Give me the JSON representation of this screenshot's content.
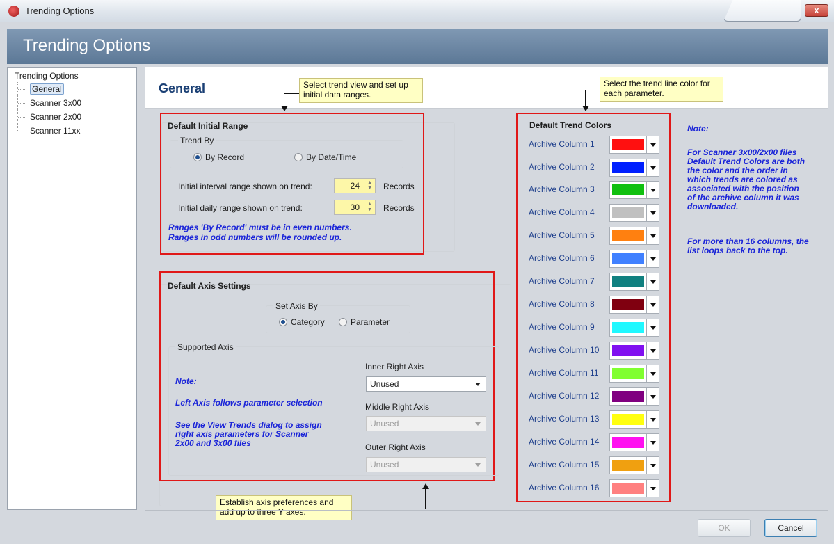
{
  "window": {
    "title": "Trending Options",
    "close_label": "x"
  },
  "banner": {
    "title": "Trending Options"
  },
  "tree": {
    "root": "Trending Options",
    "items": [
      {
        "label": "General"
      },
      {
        "label": "Scanner 3x00"
      },
      {
        "label": "Scanner 2x00"
      },
      {
        "label": "Scanner 11xx"
      }
    ]
  },
  "page": {
    "title": "General"
  },
  "callouts": {
    "trend_view": "Select trend view and set up initial data ranges.",
    "trend_color": "Select the trend line color for each parameter.",
    "axis": "Establish axis preferences and add up to three Y axes."
  },
  "initial_range": {
    "title": "Default Initial Range",
    "trend_by_title": "Trend By",
    "by_record": "By Record",
    "by_datetime": "By Date/Time",
    "selected": "By Record",
    "interval_label": "Initial interval range shown on trend:",
    "interval_value": "24",
    "daily_label": "Initial daily range shown on trend:",
    "daily_value": "30",
    "unit": "Records",
    "note_line1": "Ranges 'By Record' must be in even numbers.",
    "note_line2": "Ranges in odd numbers will be rounded up."
  },
  "axis": {
    "title": "Default Axis Settings",
    "set_axis_title": "Set Axis By",
    "category": "Category",
    "parameter": "Parameter",
    "selected": "Category",
    "supported_title": "Supported Axis",
    "note_title": "Note:",
    "note_left": "Left Axis follows parameter selection",
    "note_view_line1": "See the View Trends dialog to assign",
    "note_view_line2": "right axis parameters for Scanner",
    "note_view_line3": "2x00 and 3x00 files",
    "inner_label": "Inner Right Axis",
    "inner_value": "Unused",
    "middle_label": "Middle Right Axis",
    "middle_value": "Unused",
    "outer_label": "Outer Right Axis",
    "outer_value": "Unused"
  },
  "colors": {
    "title": "Default Trend Colors",
    "columns": [
      {
        "label": "Archive Column 1",
        "color": "#ff1010"
      },
      {
        "label": "Archive Column 2",
        "color": "#0020ff"
      },
      {
        "label": "Archive Column 3",
        "color": "#10c010"
      },
      {
        "label": "Archive Column 4",
        "color": "#c0c0c0"
      },
      {
        "label": "Archive Column 5",
        "color": "#ff8010"
      },
      {
        "label": "Archive Column 6",
        "color": "#4080ff"
      },
      {
        "label": "Archive Column 7",
        "color": "#108080"
      },
      {
        "label": "Archive Column 8",
        "color": "#800010"
      },
      {
        "label": "Archive Column 9",
        "color": "#20f8ff"
      },
      {
        "label": "Archive Column 10",
        "color": "#8010f0"
      },
      {
        "label": "Archive Column 11",
        "color": "#80ff30"
      },
      {
        "label": "Archive Column 12",
        "color": "#800080"
      },
      {
        "label": "Archive Column 13",
        "color": "#ffff10"
      },
      {
        "label": "Archive Column 14",
        "color": "#ff10f0"
      },
      {
        "label": "Archive Column 15",
        "color": "#f0a010"
      },
      {
        "label": "Archive Column 16",
        "color": "#ff8080"
      }
    ]
  },
  "side_note": {
    "title": "Note:",
    "p1_lines": [
      "For Scanner 3x00/2x00 files",
      "Default Trend Colors are both",
      "the color and the order in",
      "which trends are colored as",
      "associated with the position",
      "of the archive column it was",
      "downloaded."
    ],
    "p2_lines": [
      "For more than 16 columns, the",
      "list loops back to the top."
    ]
  },
  "buttons": {
    "ok": "OK",
    "cancel": "Cancel"
  }
}
